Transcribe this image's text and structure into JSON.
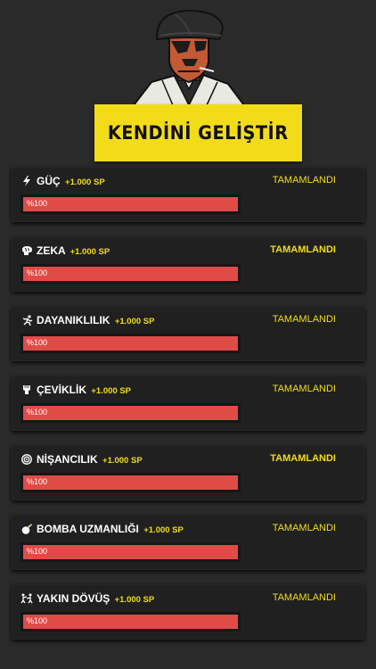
{
  "banner_title": "KENDİNİ GELİŞTİR",
  "colors": {
    "accent": "#f2dc1a",
    "bar": "#e04b47",
    "card": "#202020",
    "background": "#2a2a2a"
  },
  "skills": [
    {
      "name": "GÜÇ",
      "sp": "+1.000 SP",
      "status": "TAMAMLANDI",
      "progress_label": "%100",
      "progress": 100,
      "icon": "lightning-icon"
    },
    {
      "name": "ZEKA",
      "sp": "+1.000 SP",
      "status": "TAMAMLANDI",
      "progress_label": "%100",
      "progress": 100,
      "icon": "brain-icon"
    },
    {
      "name": "DAYANIKLILIK",
      "sp": "+1.000 SP",
      "status": "TAMAMLANDI",
      "progress_label": "%100",
      "progress": 100,
      "icon": "running-icon"
    },
    {
      "name": "ÇEVİKLİK",
      "sp": "+1.000 SP",
      "status": "TAMAMLANDI",
      "progress_label": "%100",
      "progress": 100,
      "icon": "fist-icon"
    },
    {
      "name": "NİŞANCILIK",
      "sp": "+1.000 SP",
      "status": "TAMAMLANDI",
      "progress_label": "%100",
      "progress": 100,
      "icon": "target-icon"
    },
    {
      "name": "BOMBA UZMANLIĞI",
      "sp": "+1.000 SP",
      "status": "TAMAMLANDI",
      "progress_label": "%100",
      "progress": 100,
      "icon": "bomb-icon"
    },
    {
      "name": "YAKIN DÖVÜŞ",
      "sp": "+1.000 SP",
      "status": "TAMAMLANDI",
      "progress_label": "%100",
      "progress": 100,
      "icon": "fighters-icon"
    }
  ]
}
